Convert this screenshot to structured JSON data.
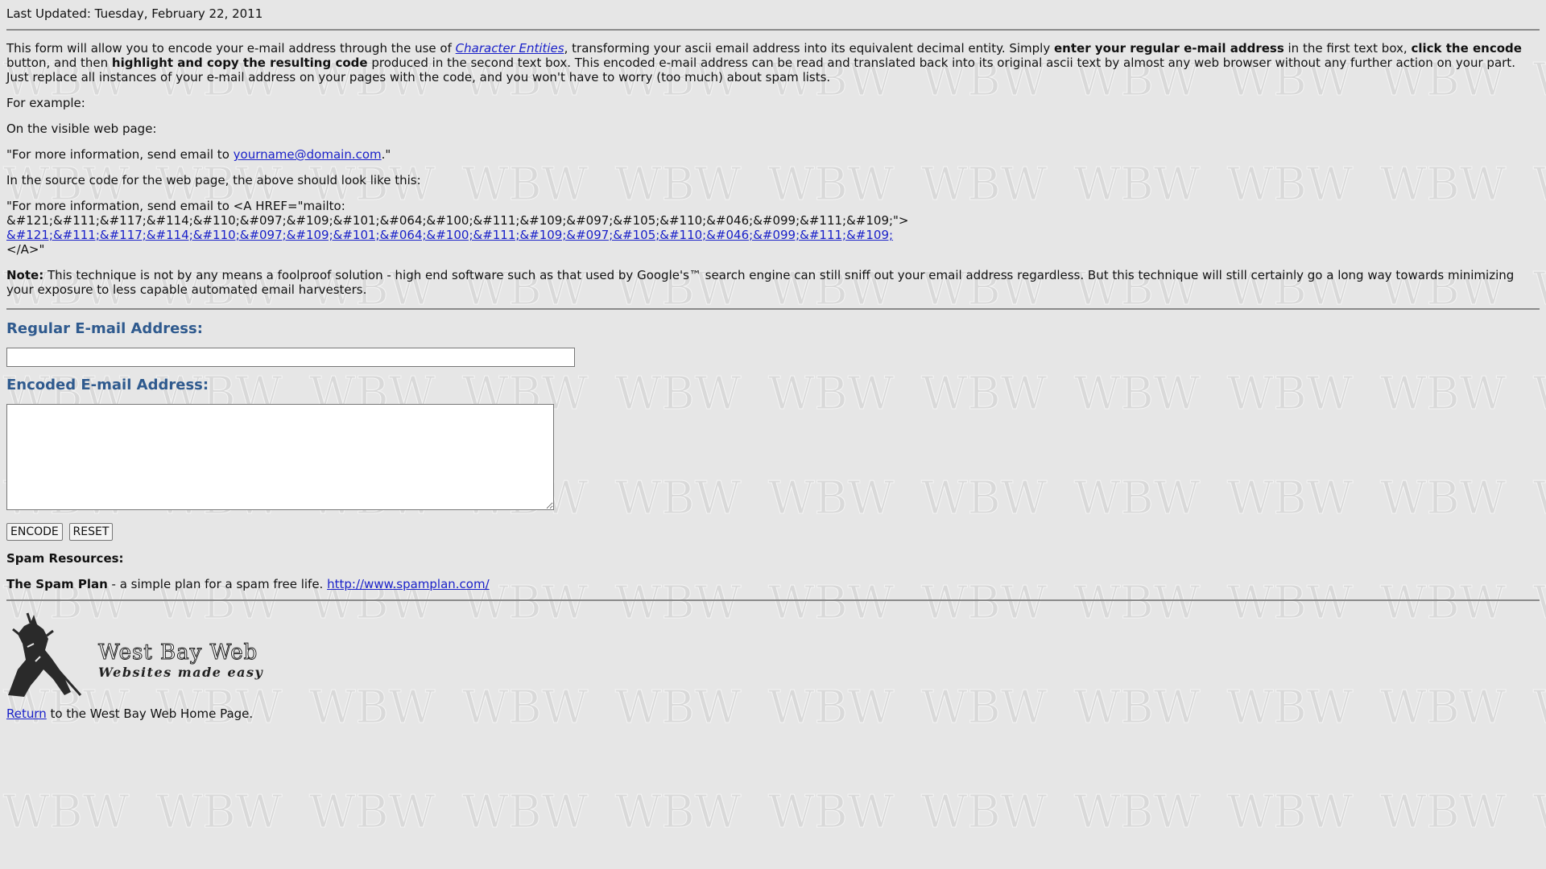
{
  "header": {
    "last_updated": "Last Updated: Tuesday, February 22, 2011"
  },
  "intro": {
    "t1": "This form will allow you to encode your e-mail address through the use of ",
    "link_character_entities": "Character Entities",
    "t2": ", transforming your ascii email address into its equivalent decimal entity. Simply ",
    "b1": "enter your regular e-mail address",
    "t3": " in the first text box, ",
    "b2": "click the encode",
    "t4": " button, and then ",
    "b3": "highlight and copy the resulting code",
    "t5": " produced in the second text box. This encoded e-mail address can be read and translated back into its original ascii text by almost any web browser without any further action on your part. Just replace all instances of your e-mail address on your pages with the code, and you won't have to worry (too much) about spam lists."
  },
  "example": {
    "for_example": "For example:",
    "visible_page": "On the visible web page:",
    "visible_prefix": "\"For more information, send email to ",
    "visible_link": "yourname@domain.com",
    "visible_suffix": ".\"",
    "source_intro": "In the source code for the web page, the above should look like this:",
    "source_line1": "\"For more information, send email to <A HREF=\"mailto:",
    "source_line2": "&#121;&#111;&#117;&#114;&#110;&#097;&#109;&#101;&#064;&#100;&#111;&#109;&#097;&#105;&#110;&#046;&#099;&#111;&#109;\">",
    "source_link": "&#121;&#111;&#117;&#114;&#110;&#097;&#109;&#101;&#064;&#100;&#111;&#109;&#097;&#105;&#110;&#046;&#099;&#111;&#109;",
    "source_line4": "</A>\""
  },
  "note": {
    "label": "Note:",
    "text": " This technique is not by any means a foolproof solution - high end software such as that used by Google's™ search engine can still sniff out your email address regardless. But this technique will still certainly go a long way towards minimizing your exposure to less capable automated email harvesters."
  },
  "form": {
    "regular_label": "Regular E-mail Address:",
    "regular_value": "",
    "encoded_label": "Encoded E-mail Address:",
    "encoded_value": "",
    "encode_button": "ENCODE",
    "reset_button": "RESET"
  },
  "resources": {
    "heading": "Spam Resources:",
    "name": "The Spam Plan",
    "desc": " - a simple plan for a spam free life. ",
    "url": "http://www.spamplan.com/"
  },
  "logo": {
    "name": "West Bay Web",
    "tagline": "Websites made easy",
    "watermark": "WBW"
  },
  "footer": {
    "return_link": "Return",
    "return_text": " to the West Bay Web Home Page."
  },
  "colors": {
    "background": "#e6e6e6",
    "heading": "#2f5a8e",
    "link": "#1a21c9"
  }
}
